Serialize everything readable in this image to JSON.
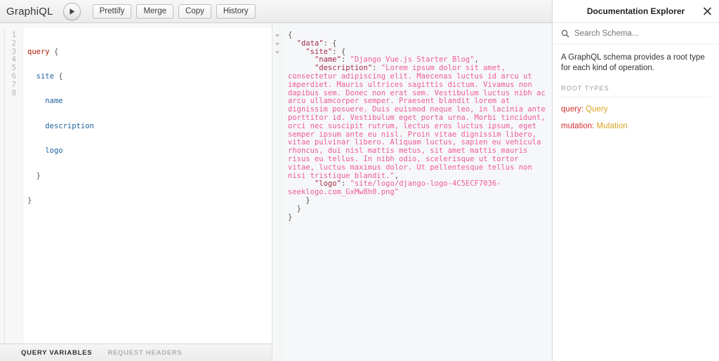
{
  "toolbar": {
    "logo": "GraphiQL",
    "execute_label": "execute-query",
    "buttons": [
      {
        "label": "Prettify"
      },
      {
        "label": "Merge"
      },
      {
        "label": "Copy"
      },
      {
        "label": "History"
      }
    ]
  },
  "query_editor": {
    "line_numbers": [
      "1",
      "2",
      "3",
      "4",
      "5",
      "6",
      "7",
      "8"
    ],
    "fold_lines": [
      1,
      2
    ],
    "lines": [
      {
        "indent": 0,
        "keyword": "query",
        "text": " {"
      },
      {
        "indent": 1,
        "field": "site",
        "text": " {"
      },
      {
        "indent": 2,
        "field": "name",
        "text": ""
      },
      {
        "indent": 2,
        "field": "description",
        "text": ""
      },
      {
        "indent": 2,
        "field": "logo",
        "text": ""
      },
      {
        "indent": 1,
        "punct": "}",
        "text": ""
      },
      {
        "indent": 0,
        "punct": "}",
        "text": ""
      },
      {
        "indent": 0,
        "text": ""
      }
    ],
    "raw": "query {\n  site {\n    name\n    description\n    logo\n  }\n}\n"
  },
  "variables_bar": {
    "tabs": [
      {
        "label": "QUERY VARIABLES",
        "active": true
      },
      {
        "label": "REQUEST HEADERS",
        "active": false
      }
    ]
  },
  "result": {
    "fold_markers": 3,
    "data_key": "data",
    "site_key": "site",
    "fields": {
      "name_key": "name",
      "name_value": "Django Vue.js Starter Blog",
      "description_key": "description",
      "description_value": "Lorem ipsum dolor sit amet, consectetur adipiscing elit. Maecenas luctus id arcu ut imperdiet. Mauris ultrices sagittis dictum. Vivamus non dapibus sem. Donec non erat sem. Vestibulum luctus nibh ac arcu ullamcorper semper. Praesent blandit lorem at dignissim posuere. Duis euismod neque leo, in lacinia ante porttitor id. Vestibulum eget porta urna. Morbi tincidunt, orci nec suscipit rutrum, lectus eros luctus ipsum, eget semper ipsum ante eu nisl. Proin vitae dignissim libero, vitae pulvinar libero. Aliquam luctus, sapien eu vehicula rhoncus, dui nisl mattis metus, sit amet mattis mauris risus eu tellus. In nibh odio, scelerisque ut tortor vitae, luctus maximus dolor. Ut pellentesque tellus non nisi tristique blandit.",
      "logo_key": "logo",
      "logo_value": "site/logo/django-logo-4C5ECF7036-seeklogo.com_GxMw8h0.png"
    }
  },
  "docs": {
    "title": "Documentation Explorer",
    "close_label": "×",
    "search_placeholder": "Search Schema...",
    "description": "A GraphQL schema provides a root type for each kind of operation.",
    "section_title": "ROOT TYPES",
    "root_types": [
      {
        "field": "query:",
        "type": "Query"
      },
      {
        "field": "mutation:",
        "type": "Mutation"
      }
    ]
  },
  "colors": {
    "keyword_red": "#b11a04",
    "field_blue": "#1f61a0",
    "json_key": "#a52a4a",
    "json_string": "#ef5b9c",
    "doc_field": "#d32f2f",
    "doc_type": "#d9a422"
  }
}
